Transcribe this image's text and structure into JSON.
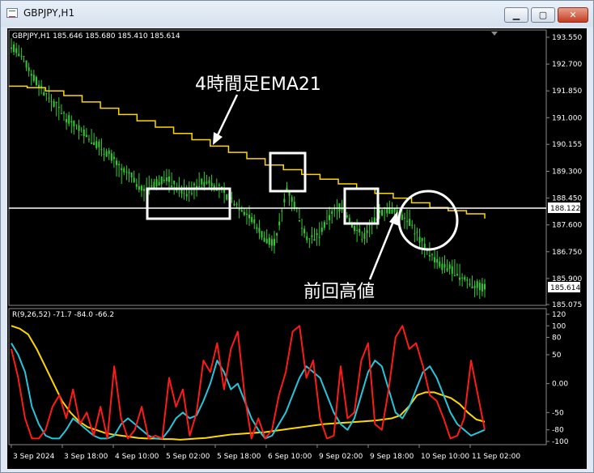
{
  "window": {
    "title": "GBPJPY,H1",
    "minimize_label": "▁",
    "maximize_label": "▢",
    "close_label": "✕"
  },
  "chart": {
    "header": "GBPJPY,H1  185.646 185.680 185.410 185.614",
    "price_ticks": [
      "193.550",
      "192.700",
      "191.850",
      "191.000",
      "190.155",
      "189.300",
      "188.450",
      "187.600",
      "186.750",
      "185.900",
      "185.075"
    ],
    "current_price_label": "185.614",
    "hline_price_label": "188.122",
    "annotation_ema": "4時間足EMA21",
    "annotation_prev_high": "前回高値",
    "colors": {
      "candles": "#32cd32",
      "ema": "#ffd700",
      "hline": "#ffffff",
      "osc_fast": "#ff1a1a",
      "osc_mid": "#26c6da",
      "osc_slow": "#ffd700"
    }
  },
  "oscillator": {
    "header": "R(9,26,52) -71.7 -84.0 -66.2",
    "ticks": [
      "120",
      "100",
      "80",
      "50",
      "0.00",
      "-50",
      "-80",
      "-100"
    ]
  },
  "time_axis": {
    "labels": [
      "3 Sep 2024",
      "3 Sep 18:00",
      "4 Sep 10:00",
      "5 Sep 02:00",
      "5 Sep 18:00",
      "6 Sep 10:00",
      "9 Sep 02:00",
      "9 Sep 18:00",
      "10 Sep 10:00",
      "11 Sep 02:00"
    ]
  },
  "chart_data": {
    "type": "line",
    "series": [
      {
        "y": [
          193.3,
          192.9,
          192.3,
          191.8,
          191.4,
          191.0,
          190.7,
          190.4,
          190.1,
          189.8,
          189.3,
          189.1,
          188.7,
          188.9,
          189.1,
          188.8,
          188.6,
          188.9,
          189.0,
          188.7,
          188.4,
          188.1,
          187.7,
          187.2,
          187.0,
          188.8,
          188.0,
          187.1,
          187.3,
          187.9,
          188.2,
          187.6,
          187.2,
          187.8,
          188.1,
          188.0,
          187.8,
          187.2,
          186.7,
          186.3,
          186.2,
          185.9,
          185.7,
          185.6
        ],
        "name": ""
      },
      {
        "y": [
          192.0,
          191.95,
          191.85,
          191.7,
          191.5,
          191.3,
          191.1,
          190.9,
          190.7,
          190.5,
          190.3,
          190.1,
          189.9,
          189.7,
          189.5,
          189.35,
          189.2,
          189.05,
          188.9,
          188.75,
          188.6,
          188.45,
          188.3,
          188.15,
          188.05,
          187.95,
          187.8
        ],
        "name": ""
      }
    ]
  }
}
